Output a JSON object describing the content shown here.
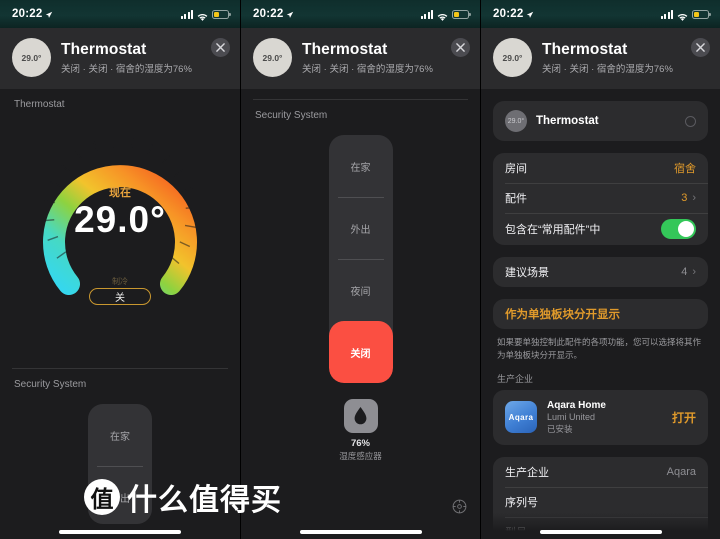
{
  "status_bar": {
    "time": "20:22",
    "location_icon": "location-arrow-icon",
    "cellular_icon": "cellular-bars-icon",
    "wifi_icon": "wifi-icon",
    "battery_icon": "battery-low-icon",
    "battery_color": "#f5c518"
  },
  "header": {
    "badge": "29.0°",
    "title": "Thermostat",
    "subtitle": "关闭 · 关闭 · 宿舍的湿度为76%",
    "close_icon": "close-icon"
  },
  "panel1": {
    "section_label": "Thermostat",
    "dial": {
      "now_label": "现在",
      "temperature": "29.0°",
      "mode_caption": "制冷",
      "mode_button": "关"
    },
    "security_label": "Security System",
    "security_options": [
      {
        "label": "在家",
        "active": false
      },
      {
        "label": "外出",
        "active": false
      }
    ]
  },
  "panel2": {
    "section_label": "Security System",
    "security_options": [
      {
        "label": "在家",
        "active": false
      },
      {
        "label": "外出",
        "active": false
      },
      {
        "label": "夜间",
        "active": false
      },
      {
        "label": "关闭",
        "active": true
      }
    ],
    "humidity": {
      "icon": "water-drop-icon",
      "value": "76%",
      "name": "湿度感应器"
    },
    "gear_icon": "gear-icon"
  },
  "panel3": {
    "accessory": {
      "name": "Thermostat",
      "badge": "29.0°",
      "status_icon": "power-circle-icon"
    },
    "settings_rows": [
      {
        "label": "房间",
        "value": "宿舍",
        "accent": true,
        "chevron": false,
        "toggle": false
      },
      {
        "label": "配件",
        "value": "3",
        "accent": true,
        "chevron": true,
        "toggle": false
      },
      {
        "label": "包含在“常用配件”中",
        "value": "",
        "accent": false,
        "chevron": false,
        "toggle": true
      }
    ],
    "scenes_row": {
      "label": "建议场景",
      "value": "4",
      "chevron": true
    },
    "notice": {
      "title": "作为单独板块分开显示",
      "body": "如果要单独控制此配件的各项功能，您可以选择将其作为单独板块分开显示。"
    },
    "manufacturer_label": "生产企业",
    "app": {
      "icon_text": "Aqara",
      "name": "Aqara Home",
      "developer": "Lumi United",
      "state": "已安装",
      "open_label": "打开"
    },
    "info_rows": [
      {
        "label": "生产企业",
        "value": "Aqara"
      },
      {
        "label": "序列号",
        "value": ""
      },
      {
        "label": "型号",
        "value": ""
      }
    ]
  },
  "watermark": {
    "badge": "值",
    "text": "什么值得买"
  }
}
